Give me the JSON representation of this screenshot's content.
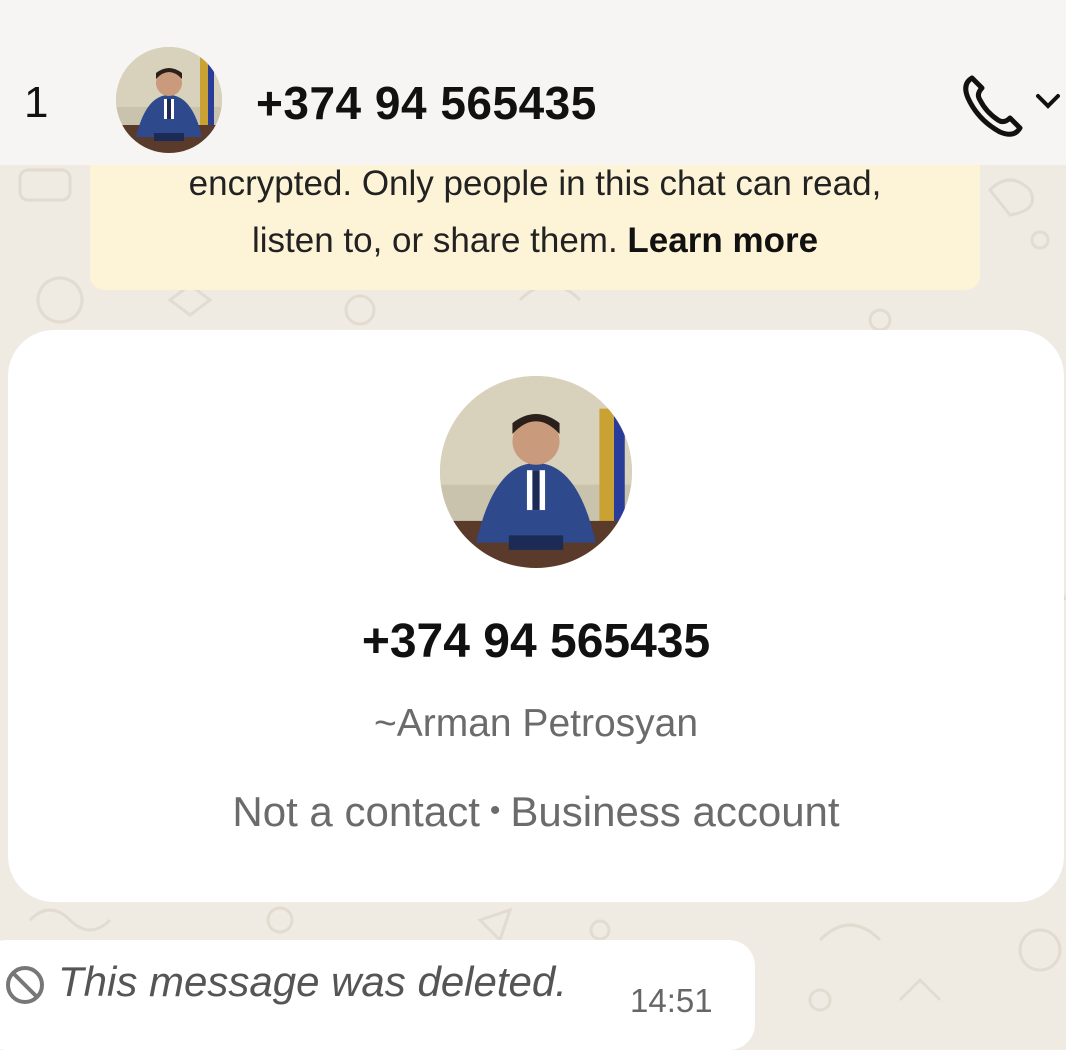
{
  "header": {
    "back_count": "1",
    "title": "+374 94 565435",
    "avatar_icon": "profile-photo",
    "call_icon": "phone-icon",
    "chevron_icon": "chevron-down-icon"
  },
  "encryption_notice": {
    "line1": "encrypted. Only people in this chat can read,",
    "line2": "listen to, or share them.",
    "link": "Learn more"
  },
  "profile_card": {
    "phone": "+374 94 565435",
    "name": "~Arman Petrosyan",
    "status_left": "Not a contact",
    "separator": "•",
    "status_right": "Business account"
  },
  "message": {
    "text": "This message was deleted.",
    "time": "14:51",
    "icon": "ban-icon"
  },
  "colors": {
    "background": "#efeae2",
    "notice_bg": "#fdf3d6",
    "card_bg": "#ffffff",
    "muted_text": "#6b6b6b"
  }
}
